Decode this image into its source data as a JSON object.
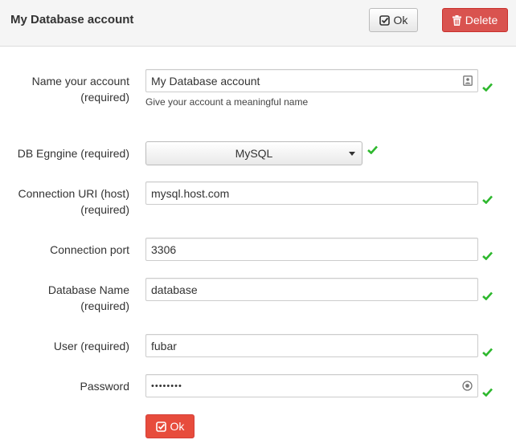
{
  "header": {
    "title": "My Database account",
    "ok_label": "Ok",
    "delete_label": "Delete"
  },
  "form": {
    "account_name": {
      "label_line1": "Name your account",
      "label_line2": "(required)",
      "value": "My Database account",
      "help": "Give your account a meaningful name"
    },
    "db_engine": {
      "label": "DB Egngine (required)",
      "selected": "MySQL"
    },
    "connection_uri": {
      "label_line1": "Connection URI (host)",
      "label_line2": "(required)",
      "value": "mysql.host.com"
    },
    "connection_port": {
      "label": "Connection port",
      "value": "3306"
    },
    "database_name": {
      "label_line1": "Database Name",
      "label_line2": "(required)",
      "value": "database"
    },
    "user": {
      "label": "User (required)",
      "value": "fubar"
    },
    "password": {
      "label": "Password",
      "value": "••••••••"
    },
    "submit_label": "Ok"
  },
  "icons": {
    "ok": "check-square-icon",
    "delete": "trash-icon",
    "valid": "checkmark-icon",
    "contact_card": "contact-card-icon",
    "reveal": "eye-icon",
    "dropdown": "caret-down-icon"
  },
  "colors": {
    "danger": "#d9534f",
    "submit": "#e74c3c",
    "valid": "#2eb82e",
    "header_bg": "#f5f5f5"
  }
}
